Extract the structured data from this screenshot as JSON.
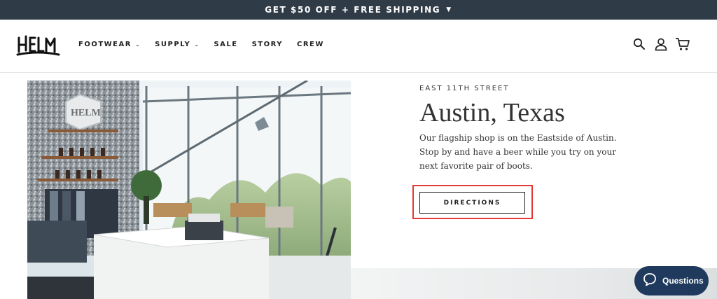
{
  "announcement": {
    "text": "GET $50 OFF + FREE SHIPPING",
    "chevron_icon": "chevron-down-icon"
  },
  "header": {
    "logo_text": "HELM",
    "nav": [
      {
        "label": "FOOTWEAR",
        "has_dropdown": true
      },
      {
        "label": "SUPPLY",
        "has_dropdown": true
      },
      {
        "label": "SALE",
        "has_dropdown": false
      },
      {
        "label": "STORY",
        "has_dropdown": false
      },
      {
        "label": "CREW",
        "has_dropdown": false
      }
    ],
    "icons": [
      "search-icon",
      "account-icon",
      "cart-icon"
    ]
  },
  "store": {
    "eyebrow": "EAST 11TH STREET",
    "title": "Austin, Texas",
    "description": "Our flagship shop is on the Eastside of Austin. Stop by and have a beer while you try on your next favorite pair of boots.",
    "button_label": "DIRECTIONS"
  },
  "chat": {
    "label": "Questions",
    "icon": "chat-bubble-icon"
  },
  "colors": {
    "announce_bg": "#2f3b47",
    "chat_bg": "#1f3a5c",
    "highlight": "#e53935"
  }
}
